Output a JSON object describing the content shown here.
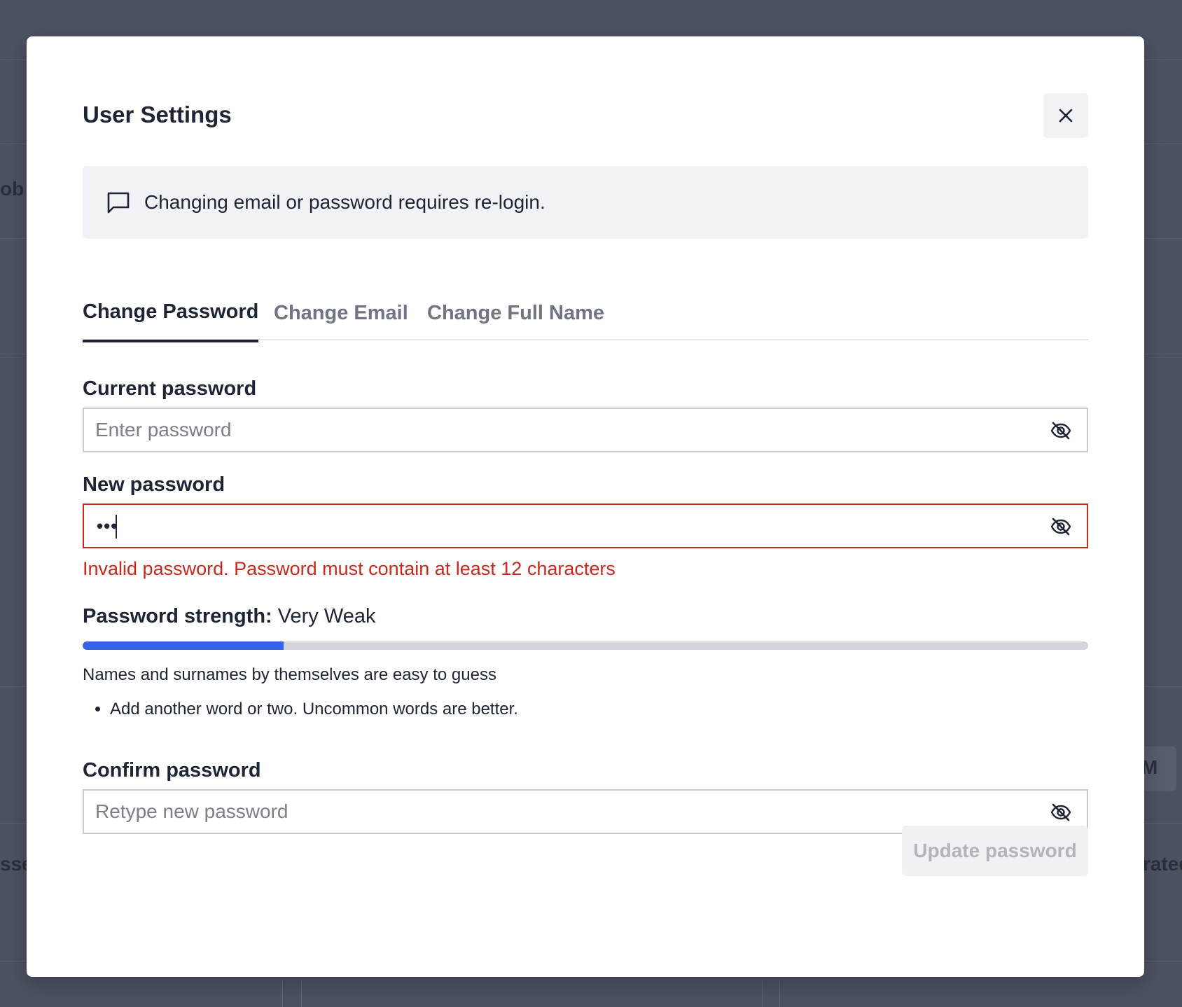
{
  "background": {
    "fragments": [
      "ob",
      "sse",
      "rated",
      "M"
    ]
  },
  "modal": {
    "title": "User Settings",
    "close_icon": "close-icon",
    "notice": {
      "icon": "message-square-icon",
      "text": "Changing email or password requires re-login."
    },
    "tabs": [
      {
        "label": "Change Password",
        "active": true
      },
      {
        "label": "Change Email",
        "active": false
      },
      {
        "label": "Change Full Name",
        "active": false
      }
    ],
    "current_password": {
      "label": "Current password",
      "placeholder": "Enter password",
      "value": "",
      "icon": "eye-off-icon"
    },
    "new_password": {
      "label": "New password",
      "masked_value": "•••",
      "icon": "eye-off-icon",
      "error": "Invalid password. Password must contain at least 12 characters"
    },
    "strength": {
      "label": "Password strength:",
      "value": "Very Weak",
      "level": 0.2,
      "color": "#3563e9",
      "warning": "Names and surnames by themselves are easy to guess",
      "suggestions": [
        "Add another word or two. Uncommon words are better."
      ]
    },
    "confirm_password": {
      "label": "Confirm password",
      "placeholder": "Retype new password",
      "value": "",
      "icon": "eye-off-icon"
    },
    "submit_label": "Update password"
  },
  "colors": {
    "overlay": "#4d5263",
    "error": "#c8281e",
    "accent": "#3563e9",
    "text": "#1d2433"
  }
}
